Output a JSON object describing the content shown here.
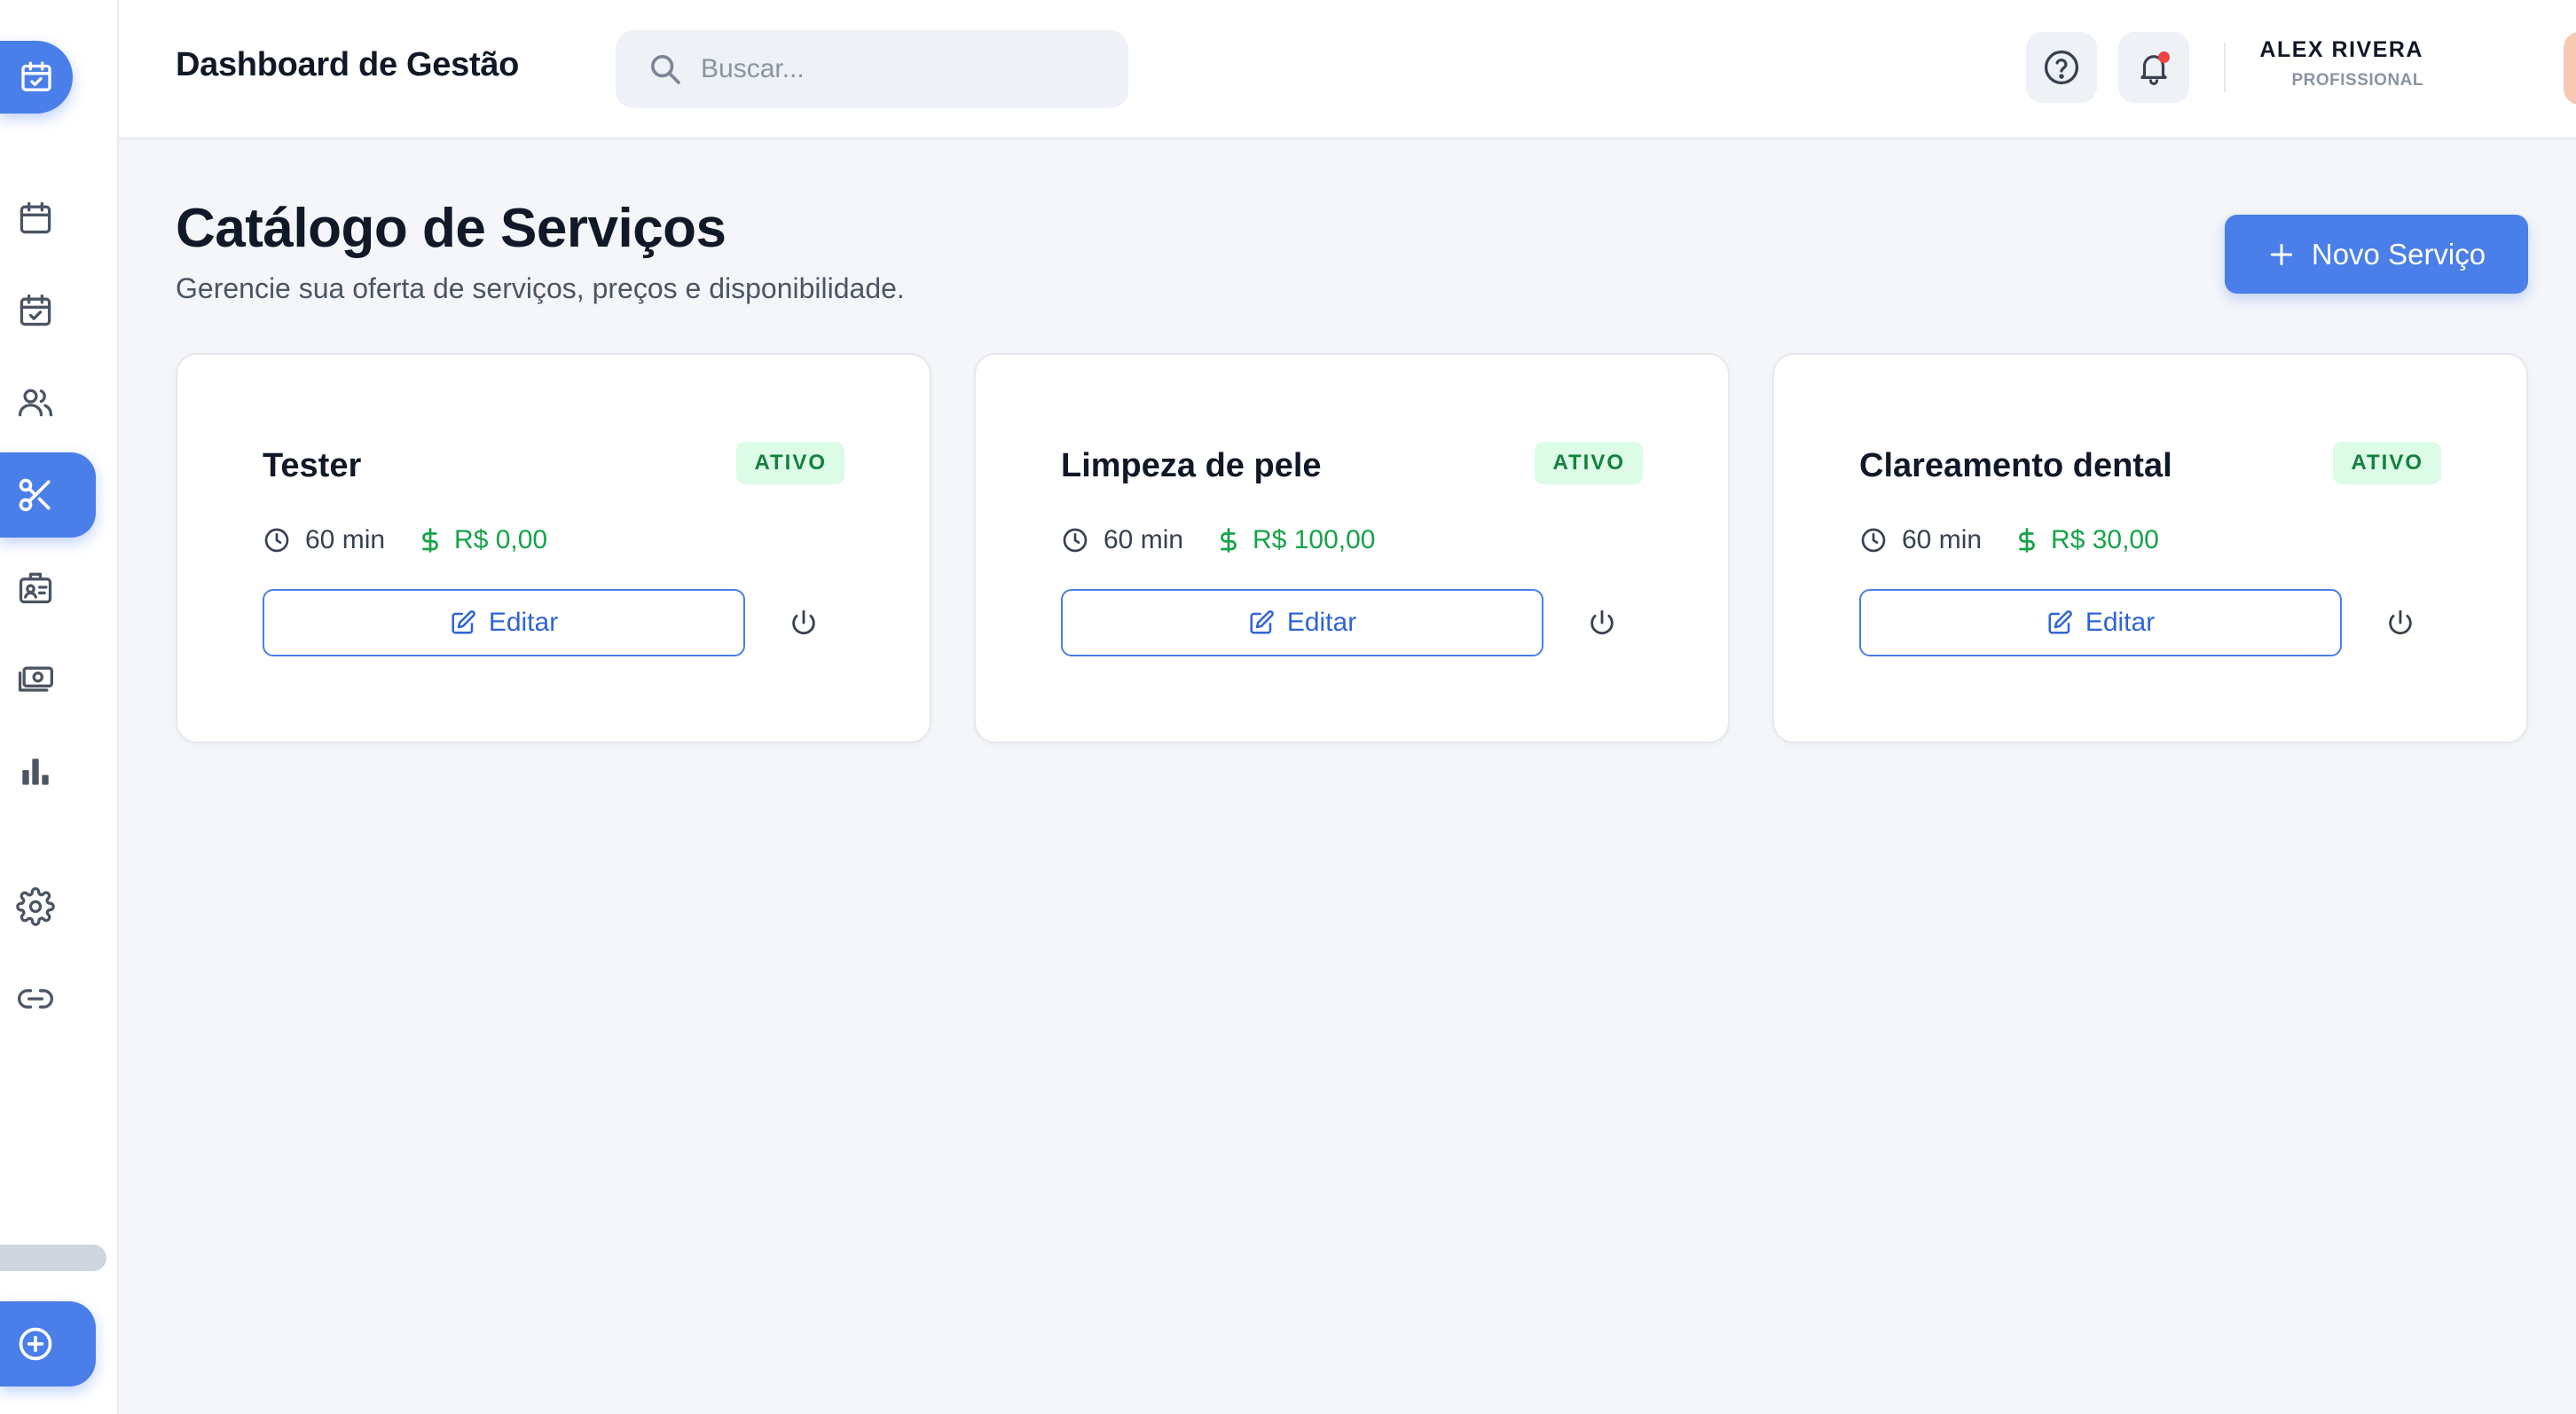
{
  "header": {
    "title": "Dashboard de Gestão",
    "search_placeholder": "Buscar...",
    "user_name": "ALEX RIVERA",
    "user_role": "PROFISSIONAL"
  },
  "sidebar": {
    "items": [
      {
        "name": "calendar",
        "icon": "calendar-icon"
      },
      {
        "name": "appointments",
        "icon": "calendar-check-icon"
      },
      {
        "name": "clients",
        "icon": "users-icon"
      },
      {
        "name": "services",
        "icon": "scissors-icon",
        "active": true
      },
      {
        "name": "professionals",
        "icon": "id-badge-icon"
      },
      {
        "name": "finance",
        "icon": "money-icon"
      },
      {
        "name": "reports",
        "icon": "bar-chart-icon"
      },
      {
        "name": "settings",
        "icon": "gear-icon"
      },
      {
        "name": "links",
        "icon": "link-icon"
      }
    ]
  },
  "page": {
    "title": "Catálogo de Serviços",
    "subtitle": "Gerencie sua oferta de serviços, preços e disponibilidade.",
    "new_button_label": "Novo Serviço"
  },
  "services": [
    {
      "name": "Tester",
      "status": "ATIVO",
      "duration": "60 min",
      "price": "R$ 0,00",
      "edit_label": "Editar"
    },
    {
      "name": "Limpeza de pele",
      "status": "ATIVO",
      "duration": "60 min",
      "price": "R$ 100,00",
      "edit_label": "Editar"
    },
    {
      "name": "Clareamento dental",
      "status": "ATIVO",
      "duration": "60 min",
      "price": "R$ 30,00",
      "edit_label": "Editar"
    }
  ],
  "colors": {
    "accent": "#4a7ee8",
    "status_active_bg": "#dcfce7",
    "status_active_text": "#15803d",
    "price": "#16a34a"
  }
}
